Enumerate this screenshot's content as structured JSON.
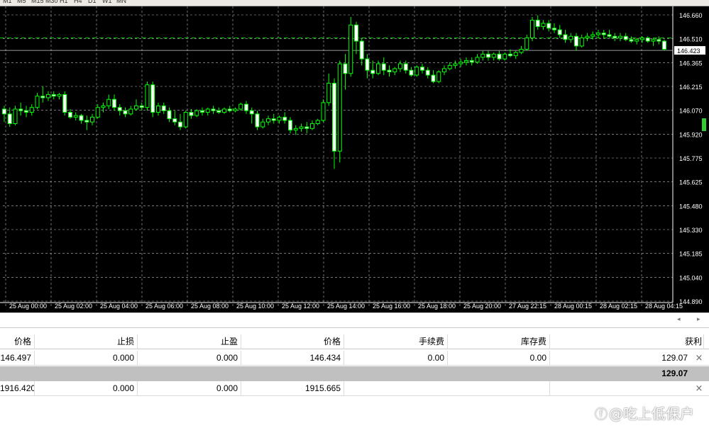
{
  "toolbar": {
    "items": [
      "M1",
      "M5",
      "M15",
      "M30",
      "H1",
      "H4",
      "D1",
      "W1",
      "MN"
    ]
  },
  "chart": {
    "symbol_bg": "#000000",
    "candle_up_color": "#00ff00",
    "candle_down_color": "#ffffff",
    "grid_color": "#bbbbbb",
    "bid_line_label": "146.423",
    "price_ticks": [
      "146.660",
      "146.510",
      "146.365",
      "146.215",
      "146.070",
      "145.920",
      "145.775",
      "145.625",
      "145.480",
      "145.330",
      "145.185",
      "145.040",
      "144.890"
    ],
    "time_ticks": [
      "25 Aug 00:00",
      "25 Aug 02:00",
      "25 Aug 04:00",
      "25 Aug 06:00",
      "25 Aug 08:00",
      "25 Aug 10:00",
      "25 Aug 12:00",
      "25 Aug 14:00",
      "25 Aug 16:00",
      "25 Aug 18:00",
      "25 Aug 20:00",
      "27 Aug 22:15",
      "28 Aug 00:15",
      "28 Aug 02:15",
      "28 Aug 04:15"
    ]
  },
  "chart_data": {
    "type": "candlestick",
    "ylim": [
      144.89,
      146.66
    ],
    "grid": true,
    "candles": [
      [
        146.06,
        146.08,
        145.98,
        146.03
      ],
      [
        146.03,
        146.07,
        145.95,
        145.97
      ],
      [
        145.97,
        146.08,
        145.96,
        146.06
      ],
      [
        146.06,
        146.1,
        146.02,
        146.05
      ],
      [
        146.05,
        146.08,
        146.01,
        146.04
      ],
      [
        146.04,
        146.09,
        146.02,
        146.07
      ],
      [
        146.07,
        146.16,
        146.06,
        146.14
      ],
      [
        146.14,
        146.2,
        146.1,
        146.13
      ],
      [
        146.13,
        146.17,
        146.11,
        146.15
      ],
      [
        146.15,
        146.17,
        146.12,
        146.14
      ],
      [
        146.14,
        146.16,
        146.12,
        146.15
      ],
      [
        146.15,
        146.17,
        146.02,
        146.04
      ],
      [
        146.04,
        146.06,
        146.0,
        146.01
      ],
      [
        146.01,
        146.04,
        145.99,
        146.02
      ],
      [
        146.02,
        146.03,
        145.97,
        145.99
      ],
      [
        145.99,
        146.02,
        145.93,
        145.98
      ],
      [
        145.98,
        146.03,
        145.96,
        146.01
      ],
      [
        146.01,
        146.09,
        146.0,
        146.07
      ],
      [
        146.07,
        146.1,
        146.04,
        146.08
      ],
      [
        146.08,
        146.15,
        146.06,
        146.12
      ],
      [
        146.12,
        146.15,
        146.05,
        146.07
      ],
      [
        146.07,
        146.09,
        146.02,
        146.05
      ],
      [
        146.05,
        146.07,
        146.01,
        146.03
      ],
      [
        146.03,
        146.08,
        146.02,
        146.06
      ],
      [
        146.06,
        146.12,
        146.05,
        146.08
      ],
      [
        146.08,
        146.1,
        146.05,
        146.07
      ],
      [
        146.07,
        146.23,
        146.05,
        146.21
      ],
      [
        146.21,
        146.23,
        146.01,
        146.04
      ],
      [
        146.04,
        146.1,
        146.02,
        146.08
      ],
      [
        146.08,
        146.1,
        146.03,
        146.05
      ],
      [
        146.05,
        146.07,
        145.98,
        146.0
      ],
      [
        146.0,
        146.05,
        145.96,
        145.98
      ],
      [
        145.98,
        146.03,
        145.93,
        145.95
      ],
      [
        145.95,
        146.05,
        145.94,
        146.04
      ],
      [
        146.04,
        146.06,
        146.0,
        146.02
      ],
      [
        146.02,
        146.06,
        146.01,
        146.05
      ],
      [
        146.05,
        146.07,
        146.02,
        146.04
      ],
      [
        146.04,
        146.07,
        146.02,
        146.06
      ],
      [
        146.06,
        146.08,
        146.03,
        146.05
      ],
      [
        146.05,
        146.07,
        146.03,
        146.04
      ],
      [
        146.04,
        146.07,
        146.03,
        146.06
      ],
      [
        146.06,
        146.08,
        146.04,
        146.05
      ],
      [
        146.05,
        146.07,
        146.04,
        146.06
      ],
      [
        146.06,
        146.1,
        146.05,
        146.09
      ],
      [
        146.09,
        146.11,
        146.03,
        146.05
      ],
      [
        146.05,
        146.07,
        145.97,
        146.03
      ],
      [
        146.03,
        146.05,
        145.93,
        145.95
      ],
      [
        145.95,
        146.0,
        145.94,
        145.98
      ],
      [
        145.98,
        146.02,
        145.96,
        146.0
      ],
      [
        146.0,
        146.03,
        145.97,
        145.99
      ],
      [
        145.99,
        146.02,
        145.97,
        146.01
      ],
      [
        146.01,
        146.04,
        145.97,
        145.99
      ],
      [
        145.99,
        146.01,
        145.91,
        145.93
      ],
      [
        145.93,
        145.96,
        145.9,
        145.94
      ],
      [
        145.94,
        145.97,
        145.92,
        145.95
      ],
      [
        145.95,
        145.98,
        145.91,
        145.94
      ],
      [
        145.94,
        145.99,
        145.93,
        145.97
      ],
      [
        145.97,
        146.0,
        145.96,
        145.99
      ],
      [
        145.99,
        146.12,
        145.98,
        146.1
      ],
      [
        146.1,
        146.28,
        146.08,
        146.22
      ],
      [
        146.22,
        146.25,
        145.69,
        145.8
      ],
      [
        145.8,
        146.36,
        145.73,
        146.34
      ],
      [
        146.34,
        146.4,
        146.18,
        146.28
      ],
      [
        146.28,
        146.63,
        146.26,
        146.58
      ],
      [
        146.58,
        146.6,
        146.4,
        146.48
      ],
      [
        146.48,
        146.5,
        146.33,
        146.37
      ],
      [
        146.37,
        146.4,
        146.25,
        146.3
      ],
      [
        146.3,
        146.36,
        146.25,
        146.28
      ],
      [
        146.28,
        146.36,
        146.27,
        146.34
      ],
      [
        146.34,
        146.38,
        146.27,
        146.3
      ],
      [
        146.3,
        146.33,
        146.26,
        146.29
      ],
      [
        146.29,
        146.32,
        146.27,
        146.31
      ],
      [
        146.31,
        146.36,
        146.29,
        146.34
      ],
      [
        146.34,
        146.36,
        146.28,
        146.3
      ],
      [
        146.3,
        146.32,
        146.26,
        146.27
      ],
      [
        146.27,
        146.33,
        146.26,
        146.32
      ],
      [
        146.32,
        146.34,
        146.28,
        146.3
      ],
      [
        146.3,
        146.32,
        146.25,
        146.27
      ],
      [
        146.27,
        146.3,
        146.22,
        146.23
      ],
      [
        146.23,
        146.3,
        146.22,
        146.29
      ],
      [
        146.29,
        146.33,
        146.27,
        146.31
      ],
      [
        146.31,
        146.35,
        146.3,
        146.33
      ],
      [
        146.33,
        146.36,
        146.31,
        146.34
      ],
      [
        146.34,
        146.37,
        146.32,
        146.35
      ],
      [
        146.35,
        146.38,
        146.33,
        146.36
      ],
      [
        146.36,
        146.38,
        146.33,
        146.35
      ],
      [
        146.35,
        146.4,
        146.34,
        146.38
      ],
      [
        146.38,
        146.42,
        146.36,
        146.4
      ],
      [
        146.4,
        146.42,
        146.36,
        146.38
      ],
      [
        146.38,
        146.41,
        146.36,
        146.4
      ],
      [
        146.4,
        146.42,
        146.36,
        146.37
      ],
      [
        146.37,
        146.41,
        146.36,
        146.4
      ],
      [
        146.4,
        146.43,
        146.38,
        146.39
      ],
      [
        146.39,
        146.42,
        146.37,
        146.41
      ],
      [
        146.41,
        146.45,
        146.4,
        146.43
      ],
      [
        146.43,
        146.52,
        146.42,
        146.5
      ],
      [
        146.5,
        146.63,
        146.48,
        146.61
      ],
      [
        146.61,
        146.64,
        146.55,
        146.57
      ],
      [
        146.57,
        146.61,
        146.55,
        146.59
      ],
      [
        146.59,
        146.61,
        146.54,
        146.56
      ],
      [
        146.56,
        146.59,
        146.53,
        146.55
      ],
      [
        146.55,
        146.58,
        146.5,
        146.52
      ],
      [
        146.52,
        146.55,
        146.47,
        146.49
      ],
      [
        146.49,
        146.53,
        146.47,
        146.51
      ],
      [
        146.51,
        146.53,
        146.42,
        146.45
      ],
      [
        146.45,
        146.52,
        146.44,
        146.5
      ],
      [
        146.5,
        146.53,
        146.48,
        146.51
      ],
      [
        146.51,
        146.54,
        146.49,
        146.52
      ],
      [
        146.52,
        146.55,
        146.5,
        146.53
      ],
      [
        146.53,
        146.55,
        146.5,
        146.52
      ],
      [
        146.52,
        146.55,
        146.5,
        146.51
      ],
      [
        146.51,
        146.53,
        146.48,
        146.5
      ],
      [
        146.5,
        146.53,
        146.48,
        146.51
      ],
      [
        146.51,
        146.53,
        146.48,
        146.49
      ],
      [
        146.49,
        146.51,
        146.47,
        146.48
      ],
      [
        146.48,
        146.5,
        146.46,
        146.49
      ],
      [
        146.49,
        146.51,
        146.47,
        146.5
      ],
      [
        146.5,
        146.51,
        146.47,
        146.48
      ],
      [
        146.48,
        146.5,
        146.45,
        146.49
      ],
      [
        146.49,
        146.51,
        146.46,
        146.48
      ],
      [
        146.48,
        146.49,
        146.42,
        146.43
      ]
    ],
    "bid": 146.423,
    "ask_line": 146.5
  },
  "scroll": {
    "left_arrow": "◂",
    "right_arrow": "▸"
  },
  "table": {
    "headers": [
      "价格",
      "止损",
      "止盈",
      "价格",
      "手续费",
      "库存费",
      "获利"
    ],
    "rows": [
      {
        "cells": [
          "146.497",
          "0.000",
          "0.000",
          "146.434",
          "0.00",
          "0.00",
          "129.07"
        ],
        "close": "×"
      },
      {
        "total": "129.07"
      },
      {
        "cells": [
          "1916.420",
          "0.000",
          "0.000",
          "1915.665",
          "",
          "",
          ""
        ],
        "close": "×"
      }
    ]
  },
  "watermark": {
    "icon": "ⓕ",
    "text": "@吃上低保户"
  }
}
